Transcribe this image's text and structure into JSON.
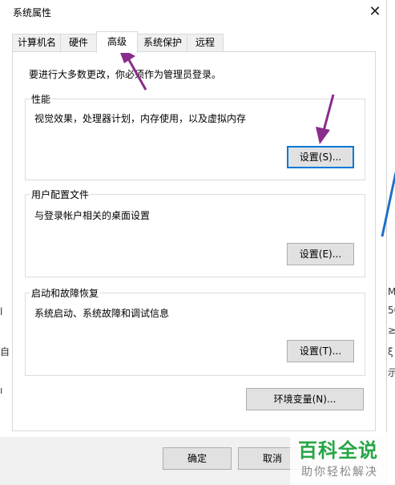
{
  "window": {
    "title": "系统属性",
    "close_glyph": "✕"
  },
  "tabs": [
    {
      "label": "计算机名"
    },
    {
      "label": "硬件"
    },
    {
      "label": "高级"
    },
    {
      "label": "系统保护"
    },
    {
      "label": "远程"
    }
  ],
  "active_tab": "高级",
  "admin_note": "要进行大多数更改，你必须作为管理员登录。",
  "performance": {
    "title": "性能",
    "description": "视觉效果，处理器计划，内存使用，以及虚拟内存",
    "button": "设置(S)..."
  },
  "user_profiles": {
    "title": "用户配置文件",
    "description": "与登录帐户相关的桌面设置",
    "button": "设置(E)..."
  },
  "startup_recovery": {
    "title": "启动和故障恢复",
    "description": "系统启动、系统故障和调试信息",
    "button": "设置(T)..."
  },
  "env_button": "环境变量(N)...",
  "footer": {
    "ok": "确定",
    "cancel": "取消"
  },
  "watermark": {
    "title": "百科全说",
    "subtitle": "助你轻松解决"
  },
  "background_fragments": {
    "left": [
      "l",
      "自",
      "ı"
    ],
    "right": [
      "M",
      "50",
      "≥",
      "ξ",
      "示"
    ]
  },
  "colors": {
    "arrow": "#8a2c8c",
    "focus": "#0078d7",
    "watermark_green": "#25a645"
  }
}
